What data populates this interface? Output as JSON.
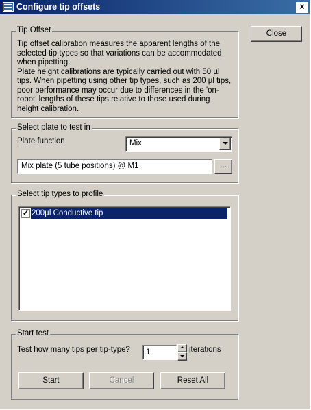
{
  "window": {
    "title": "Configure tip offsets",
    "close_glyph": "×"
  },
  "buttons": {
    "close": "Close",
    "browse": "...",
    "start": "Start",
    "cancel": "Cancel",
    "reset_all": "Reset All"
  },
  "tip_offset": {
    "legend": "Tip Offset",
    "paragraph1": "Tip offset calibration measures the apparent lengths of the selected tip types so that variations can be accommodated when pipetting.",
    "paragraph2": "Plate height calibrations are typically carried out with 50 µl tips. When pipetting using other tip types, such as 200 µl tips, poor performance may occur due to differences in the 'on-robot' lengths of these tips relative to those used during height calibration."
  },
  "plate": {
    "legend": "Select plate to test in",
    "function_label": "Plate function",
    "function_value": "Mix",
    "plate_value": "Mix plate (5 tube positions) @ M1"
  },
  "tip_types": {
    "legend": "Select tip types to profile",
    "items": [
      {
        "label": "200µl Conductive tip",
        "checked": true,
        "selected": true
      }
    ]
  },
  "start_test": {
    "legend": "Start test",
    "question": "Test how many tips per tip-type?",
    "iterations_value": "1",
    "iterations_label": "iterations"
  },
  "colors": {
    "titlebar": "#0a246a",
    "selection": "#0a246a",
    "face": "#d4d0c8"
  },
  "icons": [
    "app-icon",
    "close-icon",
    "dropdown-arrow-icon",
    "checkbox-icon",
    "spin-up-icon",
    "spin-down-icon"
  ]
}
